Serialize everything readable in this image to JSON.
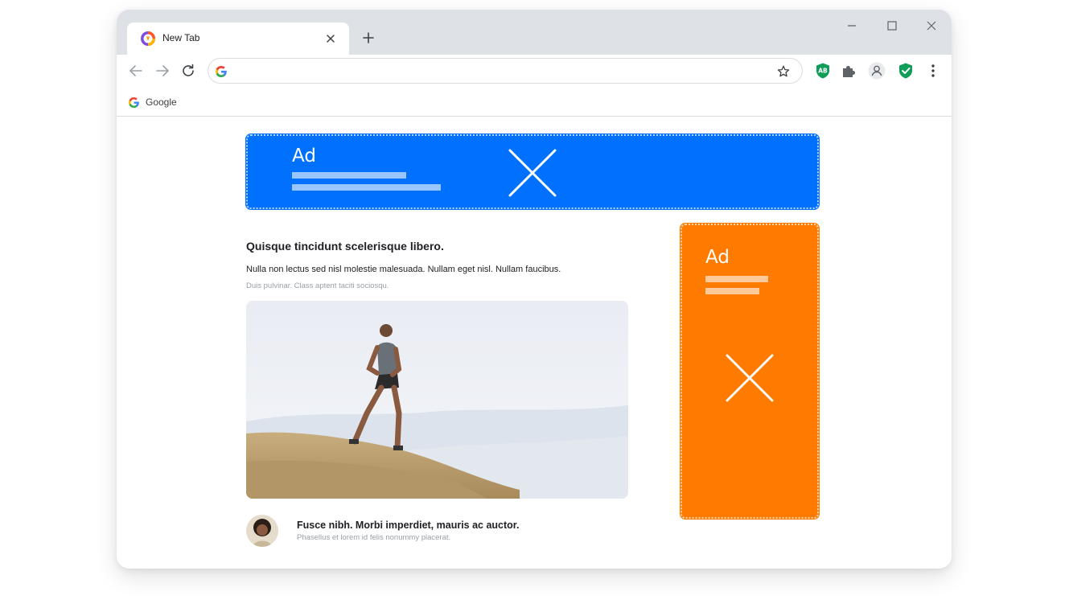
{
  "tab": {
    "title": "New Tab"
  },
  "omnibox": {
    "value": "",
    "placeholder": ""
  },
  "bookmarks": [
    {
      "label": "Google",
      "icon": "google-icon"
    }
  ],
  "extensions": [
    {
      "name": "adblock-icon",
      "text": "AB",
      "color": "#0f9d58"
    },
    {
      "name": "puzzle-icon"
    },
    {
      "name": "profile-icon"
    },
    {
      "name": "shield-check-icon",
      "color": "#0f9d58"
    },
    {
      "name": "kebab-menu-icon"
    }
  ],
  "ads": {
    "banner": {
      "label": "Ad",
      "color": "#0070ff"
    },
    "sidebar": {
      "label": "Ad",
      "color": "#ff7b00"
    }
  },
  "article": {
    "title": "Quisque tincidunt scelerisque libero.",
    "text": "Nulla non lectus sed nisl molestie malesuada. Nullam eget nisl. Nullam faucibus.",
    "subtext": "Duis pulvinar. Class aptent taciti sociosqu."
  },
  "author": {
    "title": "Fusce nibh. Morbi imperdiet, mauris ac auctor.",
    "subtitle": "Phasellus et lorem id felis nonummy placerat."
  }
}
